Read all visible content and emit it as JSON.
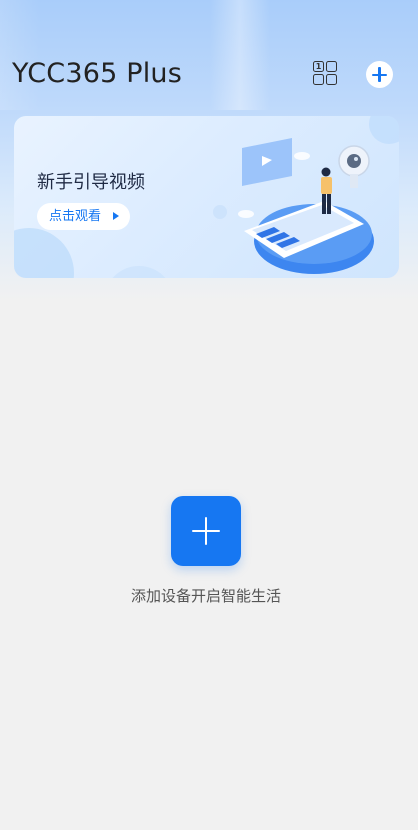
{
  "header": {
    "title": "YCC365 Plus",
    "grid_badge": "1",
    "grid_icon": "multi-view-grid-icon",
    "add_icon": "plus-circle-icon"
  },
  "banner": {
    "title": "新手引导视频",
    "watch_label": "点击观看",
    "play_icon": "play-triangle-icon"
  },
  "empty_state": {
    "add_icon": "plus-icon",
    "message": "添加设备开启智能生活"
  },
  "colors": {
    "accent": "#1677f2",
    "background": "#f1f1f1",
    "header_gradient_top": "#a9cdfa"
  }
}
